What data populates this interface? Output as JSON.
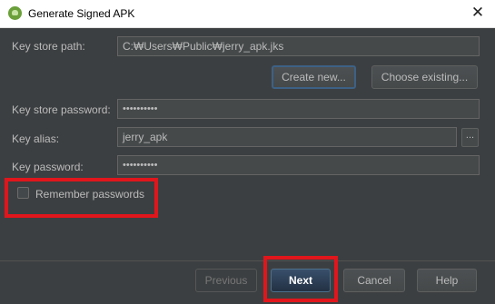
{
  "window": {
    "title": "Generate Signed APK",
    "close_glyph": "✕"
  },
  "form": {
    "key_store_path_label": "Key store path:",
    "key_store_path_value": "C:₩Users₩Public₩jerry_apk.jks",
    "create_new_label": "Create new...",
    "choose_existing_label": "Choose existing...",
    "key_store_password_label": "Key store password:",
    "key_store_password_value": "••••••••••",
    "key_alias_label": "Key alias:",
    "key_alias_value": "jerry_apk",
    "key_alias_browse_label": "...",
    "key_password_label": "Key password:",
    "key_password_value": "••••••••••",
    "remember_passwords_label": "Remember passwords",
    "remember_passwords_checked": false
  },
  "footer": {
    "previous_label": "Previous",
    "next_label": "Next",
    "cancel_label": "Cancel",
    "help_label": "Help"
  },
  "colors": {
    "background": "#3c3f41",
    "highlight": "#e0161c",
    "default_button": "#2b3e55"
  }
}
